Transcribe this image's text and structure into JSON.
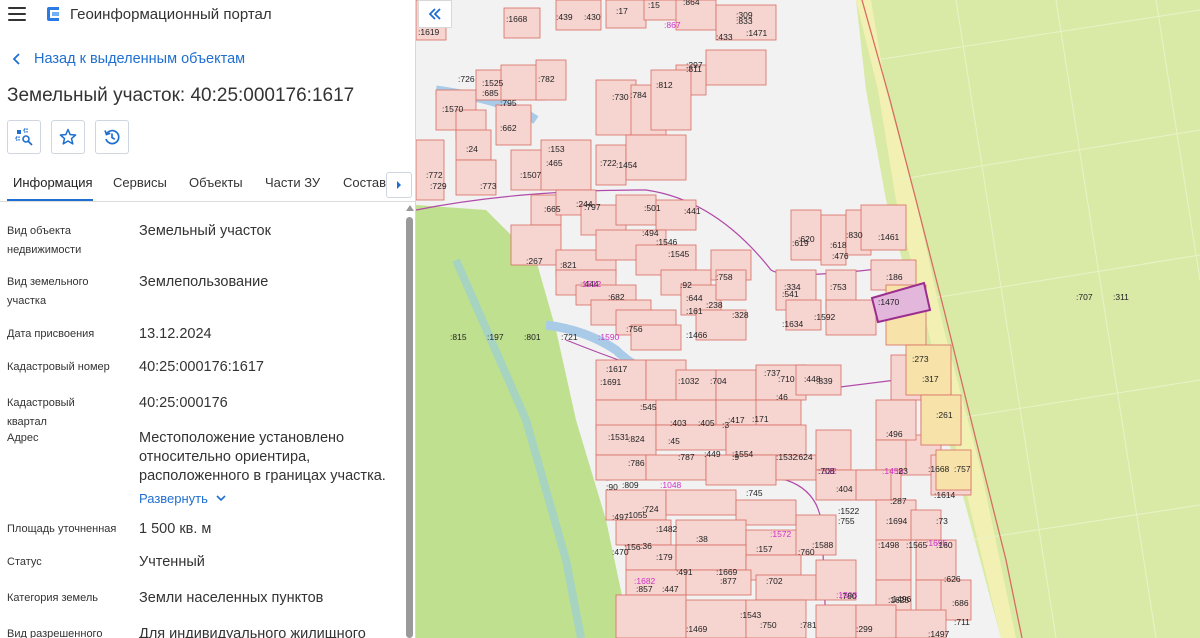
{
  "app": {
    "title": "Геоинформационный портал"
  },
  "nav": {
    "back_label": "Назад к выделенным объектам"
  },
  "object": {
    "title": "Земельный участок: 40:25:000176:1617"
  },
  "tabs": [
    {
      "label": "Информация",
      "active": true
    },
    {
      "label": "Сервисы"
    },
    {
      "label": "Объекты"
    },
    {
      "label": "Части ЗУ"
    },
    {
      "label": "Состав"
    }
  ],
  "attributes": [
    {
      "label": "Вид объекта недвижимости",
      "value": "Земельный участок"
    },
    {
      "label": "Вид земельного участка",
      "value": "Землепользование"
    },
    {
      "label": "Дата присвоения",
      "value": "13.12.2024"
    },
    {
      "label": "Кадастровый номер",
      "value": "40:25:000176:1617"
    },
    {
      "label": "Кадастровый квартал",
      "value": "40:25:000176"
    },
    {
      "label": "Адрес",
      "value": "Местоположение установлено относительно ориентира, расположенного в границах участка.",
      "expand_label": "Развернуть"
    },
    {
      "label": "Площадь уточненная",
      "value": "1 500 кв. м"
    },
    {
      "label": "Статус",
      "value": "Учтенный"
    },
    {
      "label": "Категория земель",
      "value": "Земли населенных пунктов"
    },
    {
      "label": "Вид разрешенного",
      "value": "Для индивидуального жилищного"
    }
  ],
  "map": {
    "selected_parcel": ":1617",
    "labels": [
      ":1619",
      ":1668",
      ":430",
      ":17",
      ":15",
      ":864",
      ":309",
      ":1471",
      ":433",
      ":297",
      ":811",
      ":867",
      ":833",
      ":1570",
      ":726",
      ":1525",
      ":782",
      ":795",
      ":662",
      ":730",
      ":784",
      ":812",
      ":24",
      ":153",
      ":773",
      ":1507",
      ":772",
      ":729",
      ":465",
      ":722",
      ":1454",
      ":665",
      ":244",
      ":797",
      ":501",
      ":441",
      ":494",
      ":1546",
      ":1545",
      ":685",
      ":267",
      ":821",
      ":444",
      ":1512",
      ":682",
      ":92",
      ":644",
      ":238",
      ":161",
      ":328",
      ":756",
      ":1466",
      ":758",
      ":619",
      ":620",
      ":618",
      ":476",
      ":830",
      ":1461",
      ":186",
      ":334",
      ":541",
      ":753",
      ":1592",
      ":1634",
      ":1470",
      ":273",
      ":317",
      ":261",
      ":496",
      ":1617",
      ":1691",
      ":1032",
      ":704",
      ":737",
      ":710",
      ":448",
      ":839",
      ":46",
      ":545",
      ":403",
      ":405",
      ":3",
      ":417",
      ":171",
      ":1531",
      ":824",
      ":45",
      ":786",
      ":787",
      ":449",
      ":1554",
      ":9",
      ":1532",
      ":624",
      ":522",
      ":404",
      ":708",
      ":1456",
      ":23",
      ":1668",
      ":757",
      ":90",
      ":809",
      ":1048",
      ":745",
      ":724",
      ":497",
      ":1055",
      ":1482",
      ":1572",
      ":1522",
      ":755",
      ":287",
      ":1694",
      ":1614",
      ":73",
      ":470",
      ":156",
      ":36",
      ":38",
      ":157",
      ":760",
      ":1588",
      ":1498",
      ":1565",
      ":1695",
      ":160",
      ":179",
      ":491",
      ":1669",
      ":702",
      ":1508",
      ":1625",
      ":626",
      ":1682",
      ":857",
      ":447",
      ":877",
      ":780",
      ":1496",
      ":686",
      ":1469",
      ":1543",
      ":750",
      ":781",
      ":299",
      ":1497",
      ":711",
      ":439",
      ":707",
      ":311",
      ":815",
      ":197",
      ":801",
      ":721",
      ":1590"
    ]
  },
  "colors": {
    "accent": "#1f6fd1",
    "parcel_fill": "#f6d4d0",
    "parcel_stroke": "#d96b63",
    "selected": "#9b2e8f",
    "field": "#d7e8a1",
    "forest": "#bfe08f"
  }
}
